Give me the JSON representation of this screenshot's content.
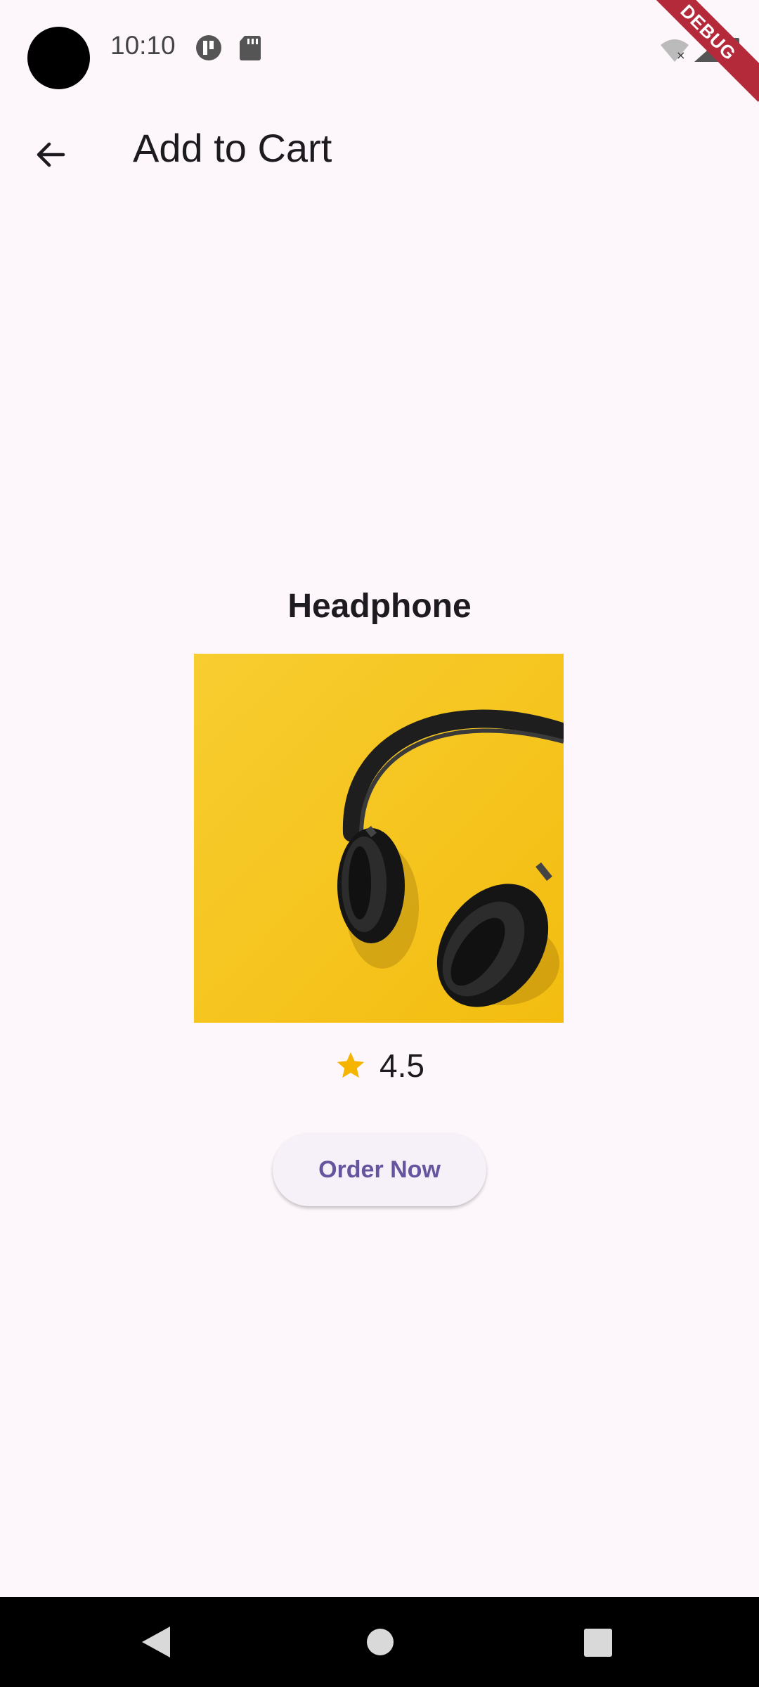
{
  "status_bar": {
    "time": "10:10",
    "debug_label": "DEBUG"
  },
  "app_bar": {
    "title": "Add to Cart",
    "back_icon": "arrow-back-icon"
  },
  "product": {
    "name": "Headphone",
    "rating": "4.5",
    "rating_icon": "star-icon",
    "image_colors": {
      "background": "#f7c927",
      "headphone": "#1e1e1e"
    }
  },
  "actions": {
    "order_label": "Order Now"
  },
  "nav_bar": {
    "back_icon": "nav-back-icon",
    "home_icon": "nav-home-icon",
    "recents_icon": "nav-recents-icon"
  },
  "colors": {
    "background": "#fdf7fb",
    "button_text": "#65559f",
    "star": "#f4b400",
    "debug_ribbon": "#b52a3a"
  }
}
